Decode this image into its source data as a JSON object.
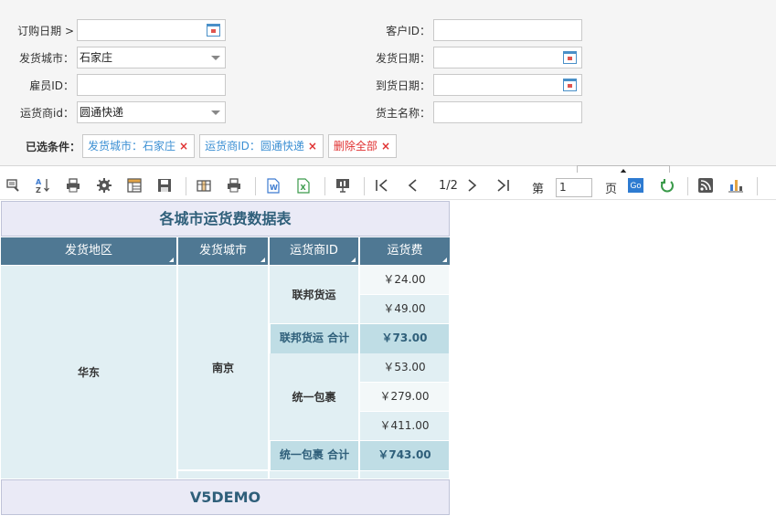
{
  "filters": {
    "order_date_label": "订购日期 >",
    "order_date_value": "",
    "customer_id_label": "客户ID：",
    "customer_id_value": "",
    "ship_city_label": "发货城市：",
    "ship_city_value": "石家庄",
    "ship_date_label": "发货日期：",
    "ship_date_value": "",
    "employee_id_label": "雇员ID：",
    "employee_id_value": "",
    "arrive_date_label": "到货日期：",
    "arrive_date_value": "",
    "carrier_id_label": "运货商id：",
    "carrier_id_value": "圆通快递",
    "shipper_name_label": "货主名称：",
    "shipper_name_value": ""
  },
  "conditions": {
    "label": "已选条件：",
    "tags": [
      {
        "text": "发货城市：石家庄",
        "remove": "×"
      },
      {
        "text": "运货商ID：圆通快递",
        "remove": "×"
      },
      {
        "text": "删除全部",
        "remove": "×"
      }
    ]
  },
  "toolbar": {
    "page_indicator": "1/2",
    "page_prefix": "第",
    "page_input": "1",
    "page_suffix": "页",
    "go_label": "Go",
    "icons": [
      "query-icon",
      "sort-icon",
      "print-icon",
      "settings-icon",
      "layout-icon",
      "save-icon",
      "columns-icon",
      "print-preview-icon",
      "word-export-icon",
      "excel-export-icon",
      "presentation-icon",
      "first-page-icon",
      "prev-page-icon",
      "next-page-icon",
      "last-page-icon",
      "refresh-icon",
      "rss-icon",
      "chart-icon"
    ]
  },
  "report": {
    "title": "各城市运货费数据表",
    "headers": [
      "发货地区",
      "发货城市",
      "运货商ID",
      "运货费"
    ],
    "region": "华东",
    "city": "南京",
    "groups": [
      {
        "carrier": "联邦货运",
        "values": [
          "￥24.00",
          "￥49.00"
        ],
        "subtotal_label": "联邦货运 合计",
        "subtotal_value": "￥73.00"
      },
      {
        "carrier": "统一包裹",
        "values": [
          "￥53.00",
          "￥279.00",
          "￥411.00"
        ],
        "subtotal_label": "统一包裹 合计",
        "subtotal_value": "￥743.00"
      }
    ],
    "footer": "V5DEMO"
  },
  "colors": {
    "header_bg": "#4f7893",
    "cell_bg": "#e1eff3",
    "subtotal_bg": "#bfdde5",
    "title_bg": "#eaeaf6",
    "tag_blue": "#3b8fd3",
    "tag_red": "#e03030"
  }
}
